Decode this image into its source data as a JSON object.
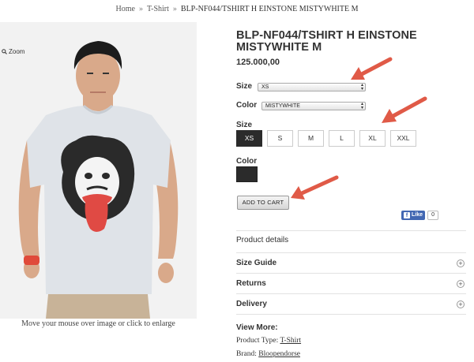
{
  "breadcrumb": {
    "home": "Home",
    "separator": "»",
    "category": "T-Shirt",
    "current": "BLP-NF044/TSHIRT H EINSTONE MISTYWHITE M"
  },
  "image": {
    "zoom_label": "Zoom",
    "caption": "Move your mouse over image or click to enlarge"
  },
  "product": {
    "title": "BLP-NF044/TSHIRT H EINSTONE MISTYWHITE M",
    "price": "125.000,00"
  },
  "options": {
    "size_label": "Size",
    "size_selected": "XS",
    "color_label": "Color",
    "color_selected": "MISTYWHITE"
  },
  "size_picker": {
    "label": "Size",
    "sizes": [
      "XS",
      "S",
      "M",
      "L",
      "XL",
      "XXL"
    ],
    "selected": "XS"
  },
  "color_picker": {
    "label": "Color",
    "swatch_color": "#2b2b2b"
  },
  "cart": {
    "add_label": "ADD TO CART"
  },
  "facebook": {
    "like_label": "Like",
    "count": "0"
  },
  "sections": {
    "product_details": "Product details",
    "size_guide": "Size Guide",
    "returns": "Returns",
    "delivery": "Delivery",
    "expand_symbol": "+"
  },
  "view_more": {
    "heading": "View More:",
    "product_type_label": "Product Type:",
    "product_type_value": "T-Shirt",
    "brand_label": "Brand:",
    "brand_value": "Bloopendorse"
  },
  "colors": {
    "annotation_arrow": "#e05a47",
    "facebook_blue": "#4267b2",
    "selected_dark": "#2b2b2b"
  },
  "icons": {
    "zoom": "magnifier-icon",
    "facebook": "facebook-f-icon",
    "expand": "plus-circle-icon",
    "annotation": "arrow-icon"
  }
}
